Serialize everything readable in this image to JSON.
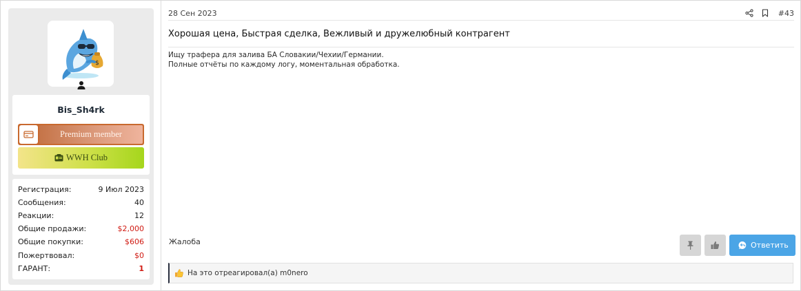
{
  "user": {
    "username": "Bis_Sh4rk",
    "avatar_icon": "shark-with-money-bag-avatar",
    "status_icon": "user-icon",
    "banners": {
      "premium": {
        "label": "Premium member",
        "icon": "card-icon",
        "color": "#c8692e"
      },
      "club": {
        "label": "WWH Club",
        "icon": "id-card-icon",
        "color": "#a5d61c"
      }
    },
    "stats": [
      {
        "label": "Регистрация:",
        "value": "9 Июл 2023"
      },
      {
        "label": "Сообщения:",
        "value": "40"
      },
      {
        "label": "Реакции:",
        "value": "12"
      },
      {
        "label": "Общие продажи:",
        "value": "$2,000",
        "color": "#d01a12"
      },
      {
        "label": "Общие покупки:",
        "value": "$606",
        "color": "#d01a12"
      },
      {
        "label": "Пожертвовал:",
        "value": "$0",
        "color": "#d01a12"
      },
      {
        "label": "ГАРАНТ:",
        "value": "1",
        "color": "#d01a12"
      }
    ]
  },
  "post": {
    "date": "28 Сен 2023",
    "number": "#43",
    "title": "Хорошая цена, Быстрая сделка, Вежливый и дружелюбный контрагент",
    "body_lines": [
      "Ищу трафера для залива БА Словакии/Чехии/Германии.",
      "Полные отчёты по каждому логу, моментальная обработка."
    ],
    "report_label": "Жалоба",
    "reply_label": "Ответить",
    "reactions_text": "На это отреагировал(а) m0nero",
    "accent_color": "#4ba5e6"
  }
}
